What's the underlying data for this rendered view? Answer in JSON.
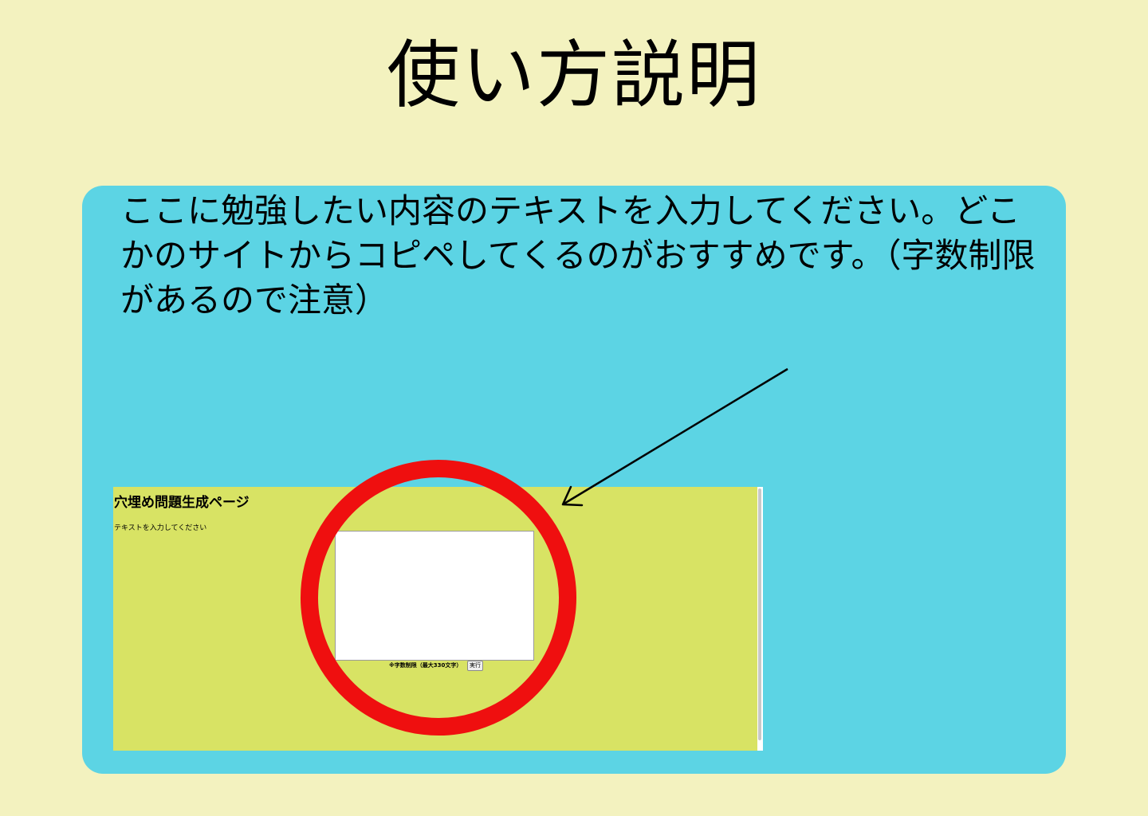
{
  "page": {
    "title": "使い方説明"
  },
  "instruction": {
    "text": "ここに勉強したい内容のテキストを入力してください。どこかのサイトからコピペしてくるのがおすすめです。（字数制限があるので注意）"
  },
  "preview": {
    "heading": "穴埋め問題生成ページ",
    "prompt": "テキストを入力してください",
    "textarea_value": "",
    "limit_note": "※字数制限（最大330文字）",
    "run_button_label": "実行"
  },
  "colors": {
    "page_background": "#f3f2bf",
    "panel_background": "#5cd4e4",
    "preview_background": "#d8e364",
    "highlight_circle": "#ef0f0f",
    "arrow": "#000000"
  }
}
